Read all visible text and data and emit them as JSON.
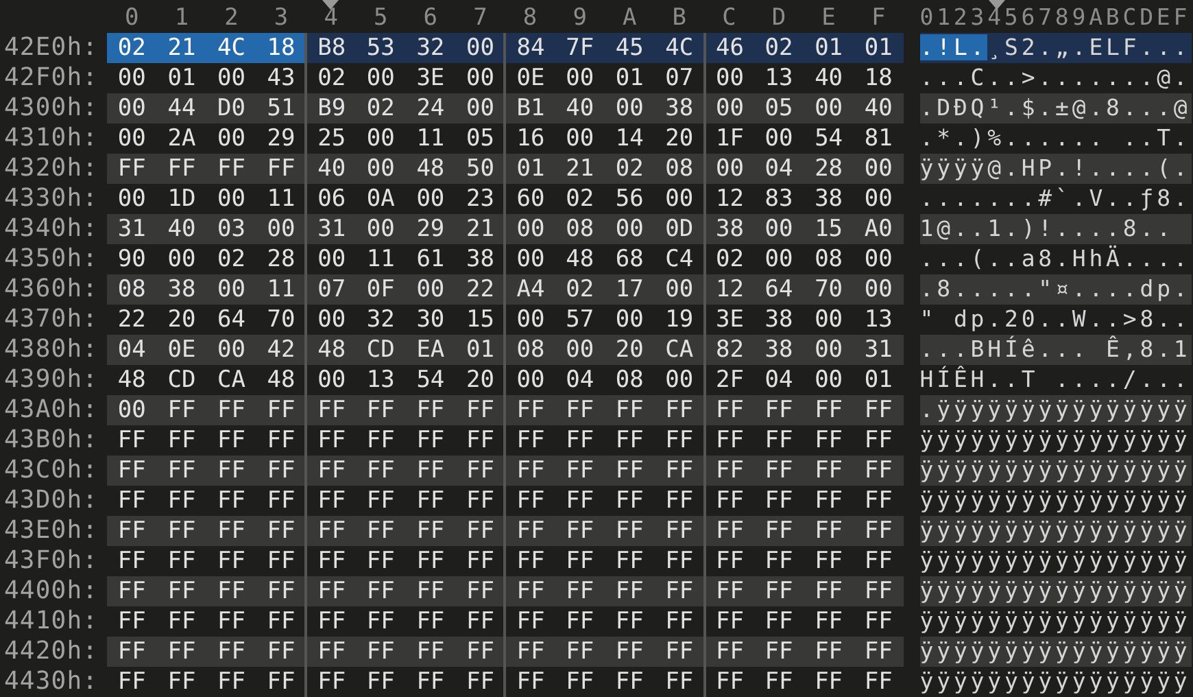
{
  "columns": [
    {
      "label": "0",
      "marked": false
    },
    {
      "label": "1",
      "marked": false
    },
    {
      "label": "2",
      "marked": false
    },
    {
      "label": "3",
      "marked": false
    },
    {
      "label": "4",
      "marked": true
    },
    {
      "label": "5",
      "marked": false
    },
    {
      "label": "6",
      "marked": false
    },
    {
      "label": "7",
      "marked": false
    },
    {
      "label": "8",
      "marked": false
    },
    {
      "label": "9",
      "marked": false
    },
    {
      "label": "A",
      "marked": false
    },
    {
      "label": "B",
      "marked": false
    },
    {
      "label": "C",
      "marked": false
    },
    {
      "label": "D",
      "marked": false
    },
    {
      "label": "E",
      "marked": false
    },
    {
      "label": "F",
      "marked": false
    }
  ],
  "ascii_header": "0123456789ABCDEF",
  "rows": [
    {
      "offset": "42E0h:",
      "current": true,
      "bytes": [
        {
          "hex": "02",
          "selected": true
        },
        {
          "hex": "21",
          "selected": true
        },
        {
          "hex": "4C",
          "selected": true
        },
        {
          "hex": "18",
          "selected": true
        },
        {
          "hex": "B8",
          "selected": false
        },
        {
          "hex": "53",
          "selected": false
        },
        {
          "hex": "32",
          "selected": false
        },
        {
          "hex": "00",
          "selected": false
        },
        {
          "hex": "84",
          "selected": false
        },
        {
          "hex": "7F",
          "selected": false
        },
        {
          "hex": "45",
          "selected": false
        },
        {
          "hex": "4C",
          "selected": false
        },
        {
          "hex": "46",
          "selected": false
        },
        {
          "hex": "02",
          "selected": false
        },
        {
          "hex": "01",
          "selected": false
        },
        {
          "hex": "01",
          "selected": false
        }
      ],
      "ascii": ".!L.¸S2.„.ELF..."
    },
    {
      "offset": "42F0h:",
      "current": false,
      "bytes": [
        {
          "hex": "00",
          "selected": false
        },
        {
          "hex": "01",
          "selected": false
        },
        {
          "hex": "00",
          "selected": false
        },
        {
          "hex": "43",
          "selected": false
        },
        {
          "hex": "02",
          "selected": false
        },
        {
          "hex": "00",
          "selected": false
        },
        {
          "hex": "3E",
          "selected": false
        },
        {
          "hex": "00",
          "selected": false
        },
        {
          "hex": "0E",
          "selected": false
        },
        {
          "hex": "00",
          "selected": false
        },
        {
          "hex": "01",
          "selected": false
        },
        {
          "hex": "07",
          "selected": false
        },
        {
          "hex": "00",
          "selected": false
        },
        {
          "hex": "13",
          "selected": false
        },
        {
          "hex": "40",
          "selected": false
        },
        {
          "hex": "18",
          "selected": false
        }
      ],
      "ascii": "...C..>.......@."
    },
    {
      "offset": "4300h:",
      "current": false,
      "bytes": [
        {
          "hex": "00",
          "selected": false
        },
        {
          "hex": "44",
          "selected": false
        },
        {
          "hex": "D0",
          "selected": false
        },
        {
          "hex": "51",
          "selected": false
        },
        {
          "hex": "B9",
          "selected": false
        },
        {
          "hex": "02",
          "selected": false
        },
        {
          "hex": "24",
          "selected": false
        },
        {
          "hex": "00",
          "selected": false
        },
        {
          "hex": "B1",
          "selected": false
        },
        {
          "hex": "40",
          "selected": false
        },
        {
          "hex": "00",
          "selected": false
        },
        {
          "hex": "38",
          "selected": false
        },
        {
          "hex": "00",
          "selected": false
        },
        {
          "hex": "05",
          "selected": false
        },
        {
          "hex": "00",
          "selected": false
        },
        {
          "hex": "40",
          "selected": false
        }
      ],
      "ascii": ".DÐQ¹.$.±@.8...@"
    },
    {
      "offset": "4310h:",
      "current": false,
      "bytes": [
        {
          "hex": "00",
          "selected": false
        },
        {
          "hex": "2A",
          "selected": false
        },
        {
          "hex": "00",
          "selected": false
        },
        {
          "hex": "29",
          "selected": false
        },
        {
          "hex": "25",
          "selected": false
        },
        {
          "hex": "00",
          "selected": false
        },
        {
          "hex": "11",
          "selected": false
        },
        {
          "hex": "05",
          "selected": false
        },
        {
          "hex": "16",
          "selected": false
        },
        {
          "hex": "00",
          "selected": false
        },
        {
          "hex": "14",
          "selected": false
        },
        {
          "hex": "20",
          "selected": false
        },
        {
          "hex": "1F",
          "selected": false
        },
        {
          "hex": "00",
          "selected": false
        },
        {
          "hex": "54",
          "selected": false
        },
        {
          "hex": "81",
          "selected": false
        }
      ],
      "ascii": ".*.)%...... ..T."
    },
    {
      "offset": "4320h:",
      "current": false,
      "bytes": [
        {
          "hex": "FF",
          "selected": false
        },
        {
          "hex": "FF",
          "selected": false
        },
        {
          "hex": "FF",
          "selected": false
        },
        {
          "hex": "FF",
          "selected": false
        },
        {
          "hex": "40",
          "selected": false
        },
        {
          "hex": "00",
          "selected": false
        },
        {
          "hex": "48",
          "selected": false
        },
        {
          "hex": "50",
          "selected": false
        },
        {
          "hex": "01",
          "selected": false
        },
        {
          "hex": "21",
          "selected": false
        },
        {
          "hex": "02",
          "selected": false
        },
        {
          "hex": "08",
          "selected": false
        },
        {
          "hex": "00",
          "selected": false
        },
        {
          "hex": "04",
          "selected": false
        },
        {
          "hex": "28",
          "selected": false
        },
        {
          "hex": "00",
          "selected": false
        }
      ],
      "ascii": "ÿÿÿÿ@.HP.!....(."
    },
    {
      "offset": "4330h:",
      "current": false,
      "bytes": [
        {
          "hex": "00",
          "selected": false
        },
        {
          "hex": "1D",
          "selected": false
        },
        {
          "hex": "00",
          "selected": false
        },
        {
          "hex": "11",
          "selected": false
        },
        {
          "hex": "06",
          "selected": false
        },
        {
          "hex": "0A",
          "selected": false
        },
        {
          "hex": "00",
          "selected": false
        },
        {
          "hex": "23",
          "selected": false
        },
        {
          "hex": "60",
          "selected": false
        },
        {
          "hex": "02",
          "selected": false
        },
        {
          "hex": "56",
          "selected": false
        },
        {
          "hex": "00",
          "selected": false
        },
        {
          "hex": "12",
          "selected": false
        },
        {
          "hex": "83",
          "selected": false
        },
        {
          "hex": "38",
          "selected": false
        },
        {
          "hex": "00",
          "selected": false
        }
      ],
      "ascii": ".......#`.V..ƒ8."
    },
    {
      "offset": "4340h:",
      "current": false,
      "bytes": [
        {
          "hex": "31",
          "selected": false
        },
        {
          "hex": "40",
          "selected": false
        },
        {
          "hex": "03",
          "selected": false
        },
        {
          "hex": "00",
          "selected": false
        },
        {
          "hex": "31",
          "selected": false
        },
        {
          "hex": "00",
          "selected": false
        },
        {
          "hex": "29",
          "selected": false
        },
        {
          "hex": "21",
          "selected": false
        },
        {
          "hex": "00",
          "selected": false
        },
        {
          "hex": "08",
          "selected": false
        },
        {
          "hex": "00",
          "selected": false
        },
        {
          "hex": "0D",
          "selected": false
        },
        {
          "hex": "38",
          "selected": false
        },
        {
          "hex": "00",
          "selected": false
        },
        {
          "hex": "15",
          "selected": false
        },
        {
          "hex": "A0",
          "selected": false
        }
      ],
      "ascii": "1@..1.)!....8.."
    },
    {
      "offset": "4350h:",
      "current": false,
      "bytes": [
        {
          "hex": "90",
          "selected": false
        },
        {
          "hex": "00",
          "selected": false
        },
        {
          "hex": "02",
          "selected": false
        },
        {
          "hex": "28",
          "selected": false
        },
        {
          "hex": "00",
          "selected": false
        },
        {
          "hex": "11",
          "selected": false
        },
        {
          "hex": "61",
          "selected": false
        },
        {
          "hex": "38",
          "selected": false
        },
        {
          "hex": "00",
          "selected": false
        },
        {
          "hex": "48",
          "selected": false
        },
        {
          "hex": "68",
          "selected": false
        },
        {
          "hex": "C4",
          "selected": false
        },
        {
          "hex": "02",
          "selected": false
        },
        {
          "hex": "00",
          "selected": false
        },
        {
          "hex": "08",
          "selected": false
        },
        {
          "hex": "00",
          "selected": false
        }
      ],
      "ascii": "...(..a8.HhÄ...."
    },
    {
      "offset": "4360h:",
      "current": false,
      "bytes": [
        {
          "hex": "08",
          "selected": false
        },
        {
          "hex": "38",
          "selected": false
        },
        {
          "hex": "00",
          "selected": false
        },
        {
          "hex": "11",
          "selected": false
        },
        {
          "hex": "07",
          "selected": false
        },
        {
          "hex": "0F",
          "selected": false
        },
        {
          "hex": "00",
          "selected": false
        },
        {
          "hex": "22",
          "selected": false
        },
        {
          "hex": "A4",
          "selected": false
        },
        {
          "hex": "02",
          "selected": false
        },
        {
          "hex": "17",
          "selected": false
        },
        {
          "hex": "00",
          "selected": false
        },
        {
          "hex": "12",
          "selected": false
        },
        {
          "hex": "64",
          "selected": false
        },
        {
          "hex": "70",
          "selected": false
        },
        {
          "hex": "00",
          "selected": false
        }
      ],
      "ascii": ".8.....\"¤....dp."
    },
    {
      "offset": "4370h:",
      "current": false,
      "bytes": [
        {
          "hex": "22",
          "selected": false
        },
        {
          "hex": "20",
          "selected": false
        },
        {
          "hex": "64",
          "selected": false
        },
        {
          "hex": "70",
          "selected": false
        },
        {
          "hex": "00",
          "selected": false
        },
        {
          "hex": "32",
          "selected": false
        },
        {
          "hex": "30",
          "selected": false
        },
        {
          "hex": "15",
          "selected": false
        },
        {
          "hex": "00",
          "selected": false
        },
        {
          "hex": "57",
          "selected": false
        },
        {
          "hex": "00",
          "selected": false
        },
        {
          "hex": "19",
          "selected": false
        },
        {
          "hex": "3E",
          "selected": false
        },
        {
          "hex": "38",
          "selected": false
        },
        {
          "hex": "00",
          "selected": false
        },
        {
          "hex": "13",
          "selected": false
        }
      ],
      "ascii": "\" dp.20..W..>8.."
    },
    {
      "offset": "4380h:",
      "current": false,
      "bytes": [
        {
          "hex": "04",
          "selected": false
        },
        {
          "hex": "0E",
          "selected": false
        },
        {
          "hex": "00",
          "selected": false
        },
        {
          "hex": "42",
          "selected": false
        },
        {
          "hex": "48",
          "selected": false
        },
        {
          "hex": "CD",
          "selected": false
        },
        {
          "hex": "EA",
          "selected": false
        },
        {
          "hex": "01",
          "selected": false
        },
        {
          "hex": "08",
          "selected": false
        },
        {
          "hex": "00",
          "selected": false
        },
        {
          "hex": "20",
          "selected": false
        },
        {
          "hex": "CA",
          "selected": false
        },
        {
          "hex": "82",
          "selected": false
        },
        {
          "hex": "38",
          "selected": false
        },
        {
          "hex": "00",
          "selected": false
        },
        {
          "hex": "31",
          "selected": false
        }
      ],
      "ascii": "...BHÍê... Ê‚8.1"
    },
    {
      "offset": "4390h:",
      "current": false,
      "bytes": [
        {
          "hex": "48",
          "selected": false
        },
        {
          "hex": "CD",
          "selected": false
        },
        {
          "hex": "CA",
          "selected": false
        },
        {
          "hex": "48",
          "selected": false
        },
        {
          "hex": "00",
          "selected": false
        },
        {
          "hex": "13",
          "selected": false
        },
        {
          "hex": "54",
          "selected": false
        },
        {
          "hex": "20",
          "selected": false
        },
        {
          "hex": "00",
          "selected": false
        },
        {
          "hex": "04",
          "selected": false
        },
        {
          "hex": "08",
          "selected": false
        },
        {
          "hex": "00",
          "selected": false
        },
        {
          "hex": "2F",
          "selected": false
        },
        {
          "hex": "04",
          "selected": false
        },
        {
          "hex": "00",
          "selected": false
        },
        {
          "hex": "01",
          "selected": false
        }
      ],
      "ascii": "HÍÊH..T ..../..."
    },
    {
      "offset": "43A0h:",
      "current": false,
      "bytes": [
        {
          "hex": "00",
          "selected": false
        },
        {
          "hex": "FF",
          "selected": false
        },
        {
          "hex": "FF",
          "selected": false
        },
        {
          "hex": "FF",
          "selected": false
        },
        {
          "hex": "FF",
          "selected": false
        },
        {
          "hex": "FF",
          "selected": false
        },
        {
          "hex": "FF",
          "selected": false
        },
        {
          "hex": "FF",
          "selected": false
        },
        {
          "hex": "FF",
          "selected": false
        },
        {
          "hex": "FF",
          "selected": false
        },
        {
          "hex": "FF",
          "selected": false
        },
        {
          "hex": "FF",
          "selected": false
        },
        {
          "hex": "FF",
          "selected": false
        },
        {
          "hex": "FF",
          "selected": false
        },
        {
          "hex": "FF",
          "selected": false
        },
        {
          "hex": "FF",
          "selected": false
        }
      ],
      "ascii": ".ÿÿÿÿÿÿÿÿÿÿÿÿÿÿÿ"
    },
    {
      "offset": "43B0h:",
      "current": false,
      "bytes": [
        {
          "hex": "FF",
          "selected": false
        },
        {
          "hex": "FF",
          "selected": false
        },
        {
          "hex": "FF",
          "selected": false
        },
        {
          "hex": "FF",
          "selected": false
        },
        {
          "hex": "FF",
          "selected": false
        },
        {
          "hex": "FF",
          "selected": false
        },
        {
          "hex": "FF",
          "selected": false
        },
        {
          "hex": "FF",
          "selected": false
        },
        {
          "hex": "FF",
          "selected": false
        },
        {
          "hex": "FF",
          "selected": false
        },
        {
          "hex": "FF",
          "selected": false
        },
        {
          "hex": "FF",
          "selected": false
        },
        {
          "hex": "FF",
          "selected": false
        },
        {
          "hex": "FF",
          "selected": false
        },
        {
          "hex": "FF",
          "selected": false
        },
        {
          "hex": "FF",
          "selected": false
        }
      ],
      "ascii": "ÿÿÿÿÿÿÿÿÿÿÿÿÿÿÿÿ"
    },
    {
      "offset": "43C0h:",
      "current": false,
      "bytes": [
        {
          "hex": "FF",
          "selected": false
        },
        {
          "hex": "FF",
          "selected": false
        },
        {
          "hex": "FF",
          "selected": false
        },
        {
          "hex": "FF",
          "selected": false
        },
        {
          "hex": "FF",
          "selected": false
        },
        {
          "hex": "FF",
          "selected": false
        },
        {
          "hex": "FF",
          "selected": false
        },
        {
          "hex": "FF",
          "selected": false
        },
        {
          "hex": "FF",
          "selected": false
        },
        {
          "hex": "FF",
          "selected": false
        },
        {
          "hex": "FF",
          "selected": false
        },
        {
          "hex": "FF",
          "selected": false
        },
        {
          "hex": "FF",
          "selected": false
        },
        {
          "hex": "FF",
          "selected": false
        },
        {
          "hex": "FF",
          "selected": false
        },
        {
          "hex": "FF",
          "selected": false
        }
      ],
      "ascii": "ÿÿÿÿÿÿÿÿÿÿÿÿÿÿÿÿ"
    },
    {
      "offset": "43D0h:",
      "current": false,
      "bytes": [
        {
          "hex": "FF",
          "selected": false
        },
        {
          "hex": "FF",
          "selected": false
        },
        {
          "hex": "FF",
          "selected": false
        },
        {
          "hex": "FF",
          "selected": false
        },
        {
          "hex": "FF",
          "selected": false
        },
        {
          "hex": "FF",
          "selected": false
        },
        {
          "hex": "FF",
          "selected": false
        },
        {
          "hex": "FF",
          "selected": false
        },
        {
          "hex": "FF",
          "selected": false
        },
        {
          "hex": "FF",
          "selected": false
        },
        {
          "hex": "FF",
          "selected": false
        },
        {
          "hex": "FF",
          "selected": false
        },
        {
          "hex": "FF",
          "selected": false
        },
        {
          "hex": "FF",
          "selected": false
        },
        {
          "hex": "FF",
          "selected": false
        },
        {
          "hex": "FF",
          "selected": false
        }
      ],
      "ascii": "ÿÿÿÿÿÿÿÿÿÿÿÿÿÿÿÿ"
    },
    {
      "offset": "43E0h:",
      "current": false,
      "bytes": [
        {
          "hex": "FF",
          "selected": false
        },
        {
          "hex": "FF",
          "selected": false
        },
        {
          "hex": "FF",
          "selected": false
        },
        {
          "hex": "FF",
          "selected": false
        },
        {
          "hex": "FF",
          "selected": false
        },
        {
          "hex": "FF",
          "selected": false
        },
        {
          "hex": "FF",
          "selected": false
        },
        {
          "hex": "FF",
          "selected": false
        },
        {
          "hex": "FF",
          "selected": false
        },
        {
          "hex": "FF",
          "selected": false
        },
        {
          "hex": "FF",
          "selected": false
        },
        {
          "hex": "FF",
          "selected": false
        },
        {
          "hex": "FF",
          "selected": false
        },
        {
          "hex": "FF",
          "selected": false
        },
        {
          "hex": "FF",
          "selected": false
        },
        {
          "hex": "FF",
          "selected": false
        }
      ],
      "ascii": "ÿÿÿÿÿÿÿÿÿÿÿÿÿÿÿÿ"
    },
    {
      "offset": "43F0h:",
      "current": false,
      "bytes": [
        {
          "hex": "FF",
          "selected": false
        },
        {
          "hex": "FF",
          "selected": false
        },
        {
          "hex": "FF",
          "selected": false
        },
        {
          "hex": "FF",
          "selected": false
        },
        {
          "hex": "FF",
          "selected": false
        },
        {
          "hex": "FF",
          "selected": false
        },
        {
          "hex": "FF",
          "selected": false
        },
        {
          "hex": "FF",
          "selected": false
        },
        {
          "hex": "FF",
          "selected": false
        },
        {
          "hex": "FF",
          "selected": false
        },
        {
          "hex": "FF",
          "selected": false
        },
        {
          "hex": "FF",
          "selected": false
        },
        {
          "hex": "FF",
          "selected": false
        },
        {
          "hex": "FF",
          "selected": false
        },
        {
          "hex": "FF",
          "selected": false
        },
        {
          "hex": "FF",
          "selected": false
        }
      ],
      "ascii": "ÿÿÿÿÿÿÿÿÿÿÿÿÿÿÿÿ"
    },
    {
      "offset": "4400h:",
      "current": false,
      "bytes": [
        {
          "hex": "FF",
          "selected": false
        },
        {
          "hex": "FF",
          "selected": false
        },
        {
          "hex": "FF",
          "selected": false
        },
        {
          "hex": "FF",
          "selected": false
        },
        {
          "hex": "FF",
          "selected": false
        },
        {
          "hex": "FF",
          "selected": false
        },
        {
          "hex": "FF",
          "selected": false
        },
        {
          "hex": "FF",
          "selected": false
        },
        {
          "hex": "FF",
          "selected": false
        },
        {
          "hex": "FF",
          "selected": false
        },
        {
          "hex": "FF",
          "selected": false
        },
        {
          "hex": "FF",
          "selected": false
        },
        {
          "hex": "FF",
          "selected": false
        },
        {
          "hex": "FF",
          "selected": false
        },
        {
          "hex": "FF",
          "selected": false
        },
        {
          "hex": "FF",
          "selected": false
        }
      ],
      "ascii": "ÿÿÿÿÿÿÿÿÿÿÿÿÿÿÿÿ"
    },
    {
      "offset": "4410h:",
      "current": false,
      "bytes": [
        {
          "hex": "FF",
          "selected": false
        },
        {
          "hex": "FF",
          "selected": false
        },
        {
          "hex": "FF",
          "selected": false
        },
        {
          "hex": "FF",
          "selected": false
        },
        {
          "hex": "FF",
          "selected": false
        },
        {
          "hex": "FF",
          "selected": false
        },
        {
          "hex": "FF",
          "selected": false
        },
        {
          "hex": "FF",
          "selected": false
        },
        {
          "hex": "FF",
          "selected": false
        },
        {
          "hex": "FF",
          "selected": false
        },
        {
          "hex": "FF",
          "selected": false
        },
        {
          "hex": "FF",
          "selected": false
        },
        {
          "hex": "FF",
          "selected": false
        },
        {
          "hex": "FF",
          "selected": false
        },
        {
          "hex": "FF",
          "selected": false
        },
        {
          "hex": "FF",
          "selected": false
        }
      ],
      "ascii": "ÿÿÿÿÿÿÿÿÿÿÿÿÿÿÿÿ"
    },
    {
      "offset": "4420h:",
      "current": false,
      "bytes": [
        {
          "hex": "FF",
          "selected": false
        },
        {
          "hex": "FF",
          "selected": false
        },
        {
          "hex": "FF",
          "selected": false
        },
        {
          "hex": "FF",
          "selected": false
        },
        {
          "hex": "FF",
          "selected": false
        },
        {
          "hex": "FF",
          "selected": false
        },
        {
          "hex": "FF",
          "selected": false
        },
        {
          "hex": "FF",
          "selected": false
        },
        {
          "hex": "FF",
          "selected": false
        },
        {
          "hex": "FF",
          "selected": false
        },
        {
          "hex": "FF",
          "selected": false
        },
        {
          "hex": "FF",
          "selected": false
        },
        {
          "hex": "FF",
          "selected": false
        },
        {
          "hex": "FF",
          "selected": false
        },
        {
          "hex": "FF",
          "selected": false
        },
        {
          "hex": "FF",
          "selected": false
        }
      ],
      "ascii": "ÿÿÿÿÿÿÿÿÿÿÿÿÿÿÿÿ"
    },
    {
      "offset": "4430h:",
      "current": false,
      "bytes": [
        {
          "hex": "FF",
          "selected": false
        },
        {
          "hex": "FF",
          "selected": false
        },
        {
          "hex": "FF",
          "selected": false
        },
        {
          "hex": "FF",
          "selected": false
        },
        {
          "hex": "FF",
          "selected": false
        },
        {
          "hex": "FF",
          "selected": false
        },
        {
          "hex": "FF",
          "selected": false
        },
        {
          "hex": "FF",
          "selected": false
        },
        {
          "hex": "FF",
          "selected": false
        },
        {
          "hex": "FF",
          "selected": false
        },
        {
          "hex": "FF",
          "selected": false
        },
        {
          "hex": "FF",
          "selected": false
        },
        {
          "hex": "FF",
          "selected": false
        },
        {
          "hex": "FF",
          "selected": false
        },
        {
          "hex": "FF",
          "selected": false
        },
        {
          "hex": "FF",
          "selected": false
        }
      ],
      "ascii": "ÿÿÿÿÿÿÿÿÿÿÿÿÿÿÿÿ"
    }
  ]
}
